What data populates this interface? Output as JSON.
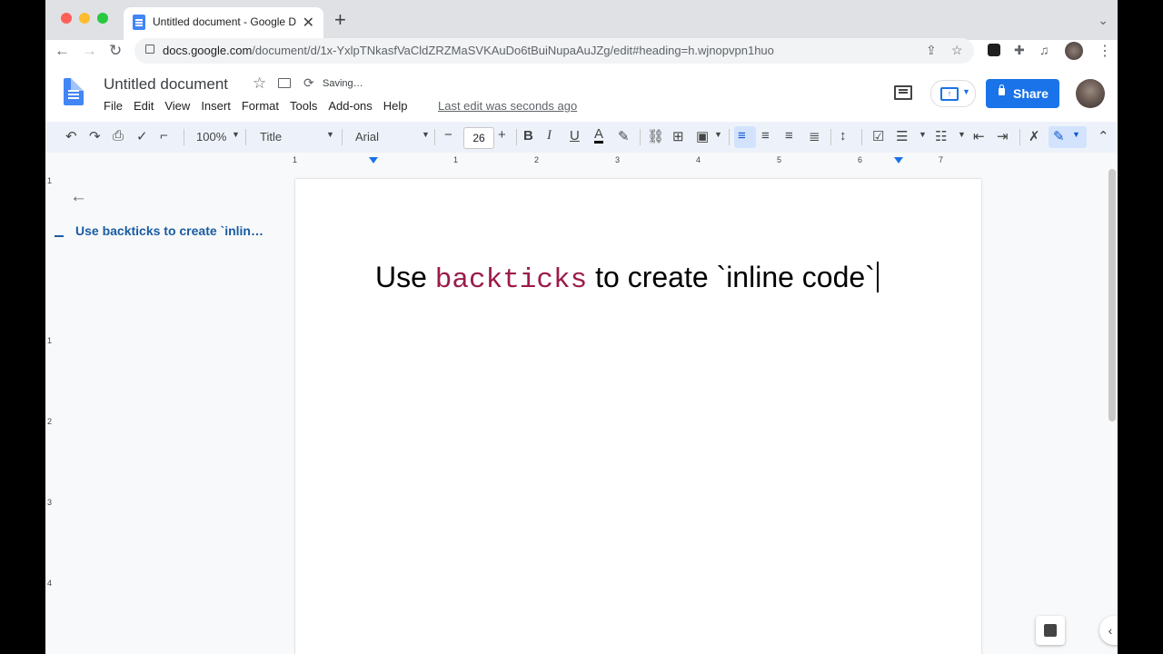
{
  "browser": {
    "tab_title": "Untitled document - Google Do",
    "tab_close": "✕",
    "new_tab": "+",
    "url_host": "docs.google.com",
    "url_path": "/document/d/1x-YxlpTNkasfVaCldZRZMaSVKAuDo6tBuiNupaAuJZg/edit#heading=h.wjnopvpn1huo"
  },
  "docs": {
    "title": "Untitled document",
    "status": "Saving…",
    "menu": [
      "File",
      "Edit",
      "View",
      "Insert",
      "Format",
      "Tools",
      "Add-ons",
      "Help"
    ],
    "last_edit": "Last edit was seconds ago",
    "share_label": "Share"
  },
  "toolbar": {
    "zoom": "100%",
    "style": "Title",
    "font": "Arial",
    "font_size": "26",
    "minus": "−",
    "plus": "+",
    "bold": "B",
    "italic": "I",
    "underline": "U",
    "text_color": "A"
  },
  "ruler": {
    "h_numbers": [
      "1",
      "1",
      "2",
      "3",
      "4",
      "5",
      "6",
      "7"
    ],
    "v_numbers": [
      "1",
      "1",
      "2",
      "3",
      "4"
    ]
  },
  "outline": {
    "item": "Use backticks to create `inlin…"
  },
  "document": {
    "text_before": "Use ",
    "code": "backticks",
    "text_after": " to create `inline code`"
  },
  "colors": {
    "accent": "#1a73e8",
    "code_text": "#9b1b4a",
    "outline_text": "#1a5ca3",
    "toolbar_bg": "#edf2fa"
  }
}
